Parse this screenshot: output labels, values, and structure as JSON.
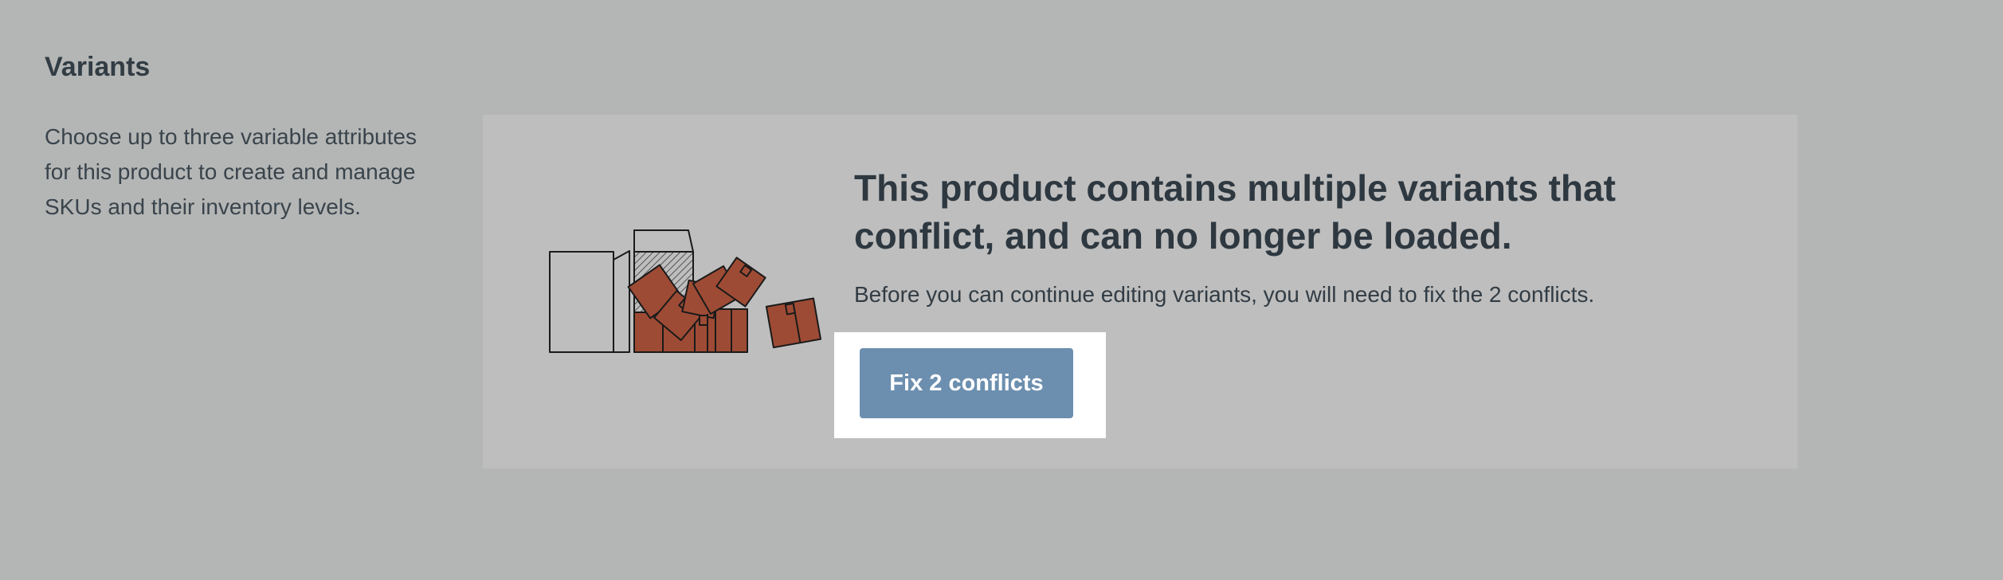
{
  "section": {
    "title": "Variants",
    "description": "Choose up to three variable attributes for this product to create and manage SKUs and their inventory levels."
  },
  "conflict_panel": {
    "heading": "This product contains multiple variants that conflict, and can no longer be loaded.",
    "message": "Before you can continue editing variants, you will need to fix the 2 conflicts.",
    "illustration_icon": "scattered-boxes-icon",
    "fix_button_label": "Fix 2 conflicts"
  },
  "colors": {
    "page_background": "#b4b6b5",
    "panel_background": "#bebebe",
    "button_background": "#6c8faf",
    "box_brown": "#9e4b35",
    "text_dark": "#2e3840"
  }
}
